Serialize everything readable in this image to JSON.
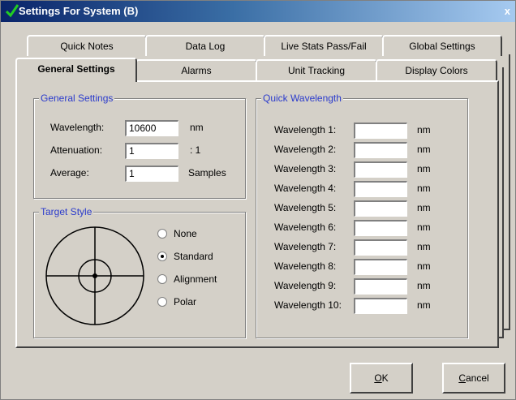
{
  "window": {
    "title": "Settings For System (B)",
    "close_glyph": "x"
  },
  "tabs_row1": [
    {
      "label": "Quick Notes"
    },
    {
      "label": "Data Log"
    },
    {
      "label": "Live Stats Pass/Fail"
    },
    {
      "label": "Global Settings"
    }
  ],
  "tabs_row2": [
    {
      "label": "General Settings",
      "active": true
    },
    {
      "label": "Alarms"
    },
    {
      "label": "Unit Tracking"
    },
    {
      "label": "Display Colors"
    }
  ],
  "general_settings": {
    "title": "General Settings",
    "wavelength": {
      "label": "Wavelength:",
      "value": "10600",
      "unit": "nm"
    },
    "attenuation": {
      "label": "Attenuation:",
      "value": "1",
      "unit": ": 1"
    },
    "average": {
      "label": "Average:",
      "value": "1",
      "unit": "Samples"
    }
  },
  "target_style": {
    "title": "Target Style",
    "options": [
      {
        "label": "None",
        "selected": false
      },
      {
        "label": "Standard",
        "selected": true
      },
      {
        "label": "Alignment",
        "selected": false
      },
      {
        "label": "Polar",
        "selected": false
      }
    ]
  },
  "quick_wavelength": {
    "title": "Quick Wavelength",
    "unit": "nm",
    "items": [
      {
        "label": "Wavelength 1:",
        "value": ""
      },
      {
        "label": "Wavelength 2:",
        "value": ""
      },
      {
        "label": "Wavelength 3:",
        "value": ""
      },
      {
        "label": "Wavelength 4:",
        "value": ""
      },
      {
        "label": "Wavelength 5:",
        "value": ""
      },
      {
        "label": "Wavelength 6:",
        "value": ""
      },
      {
        "label": "Wavelength 7:",
        "value": ""
      },
      {
        "label": "Wavelength 8:",
        "value": ""
      },
      {
        "label": "Wavelength 9:",
        "value": ""
      },
      {
        "label": "Wavelength 10:",
        "value": ""
      }
    ]
  },
  "buttons": {
    "ok": {
      "mnemonic": "O",
      "rest": "K"
    },
    "cancel": {
      "mnemonic": "C",
      "rest": "ancel"
    }
  },
  "icons": {
    "title_icon": "check-icon",
    "target_preview": "crosshair-target-icon"
  },
  "colors": {
    "titlebar_start": "#0a246a",
    "titlebar_end": "#a6caf0",
    "groupbox_title": "#2b3bcc",
    "face": "#d4d0c8"
  }
}
